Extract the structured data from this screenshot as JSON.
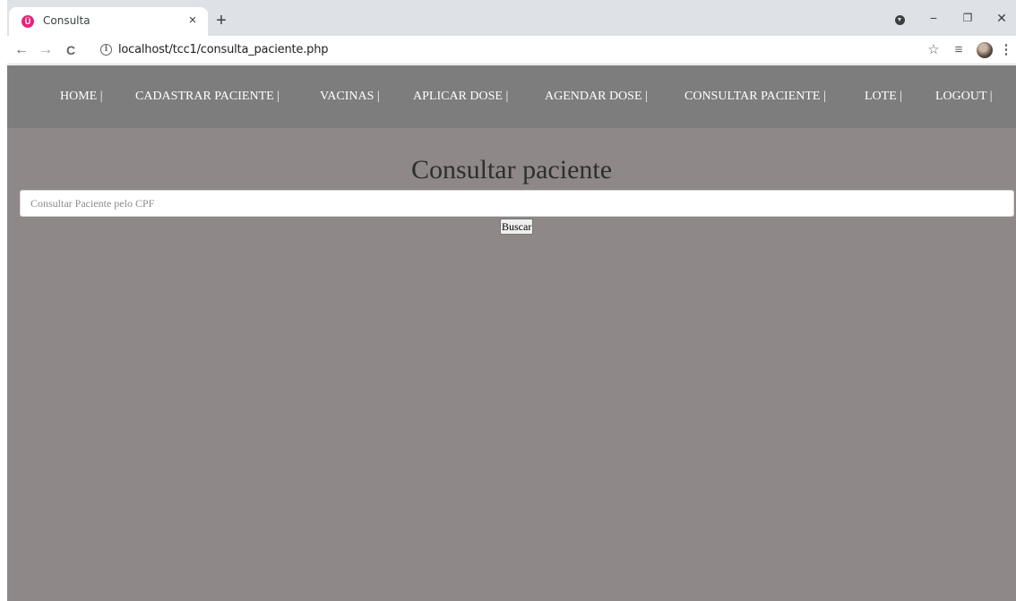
{
  "browser": {
    "tab": {
      "title": "Consulta",
      "favicon_letter": "Ü",
      "close_glyph": "×"
    },
    "new_tab_glyph": "+",
    "window_controls": {
      "minimize": "−",
      "restore": "❐",
      "close": "✕"
    },
    "toolbar": {
      "back_glyph": "←",
      "forward_glyph": "→",
      "reload_glyph": "C",
      "url": "localhost/tcc1/consulta_paciente.php",
      "star_glyph": "☆",
      "media_glyph": "≡",
      "menu_glyph": "⋮"
    }
  },
  "page": {
    "nav": [
      {
        "label": "HOME |"
      },
      {
        "label": "CADASTRAR PACIENTE |"
      },
      {
        "label": "VACINAS |"
      },
      {
        "label": "APLICAR DOSE |"
      },
      {
        "label": "AGENDAR DOSE |"
      },
      {
        "label": "CONSULTAR PACIENTE |"
      },
      {
        "label": "LOTE |"
      },
      {
        "label": "LOGOUT |"
      }
    ],
    "title": "Consultar paciente",
    "search": {
      "placeholder": "Consultar Paciente pelo CPF",
      "value": ""
    },
    "button_label": "Buscar"
  },
  "colors": {
    "page_background": "#8e8888",
    "navbar_background": "#7c7d7c",
    "tab_strip": "#dee1e6",
    "favicon": "#e8237a"
  }
}
